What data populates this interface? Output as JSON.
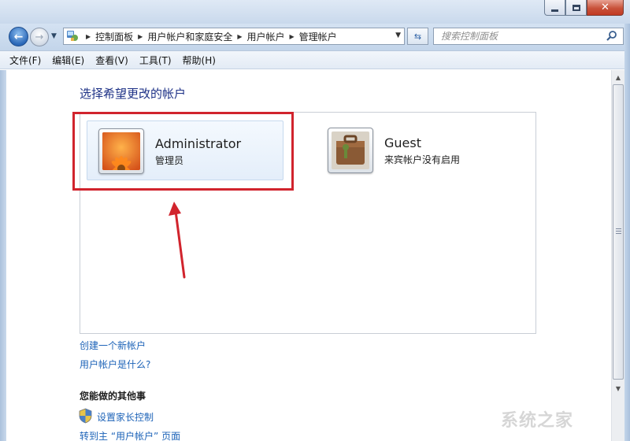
{
  "window": {
    "min_glyph": "",
    "close_glyph": "✕"
  },
  "nav": {
    "breadcrumbs": [
      "控制面板",
      "用户帐户和家庭安全",
      "用户帐户",
      "管理帐户"
    ],
    "search_placeholder": "搜索控制面板"
  },
  "menu": {
    "items": [
      "文件(F)",
      "编辑(E)",
      "查看(V)",
      "工具(T)",
      "帮助(H)"
    ]
  },
  "content": {
    "heading": "选择希望更改的帐户",
    "accounts": [
      {
        "name": "Administrator",
        "role": "管理员"
      },
      {
        "name": "Guest",
        "role": "来宾帐户没有启用"
      }
    ],
    "links": {
      "create": "创建一个新帐户",
      "what": "用户帐户是什么?"
    },
    "other_title": "您能做的其他事",
    "parental": "设置家长控制",
    "goto": "转到主 “用户帐户” 页面"
  },
  "watermark": "系统之家",
  "colors": {
    "link": "#1d63b8",
    "heading": "#1e3287",
    "highlight": "#d1242d"
  }
}
